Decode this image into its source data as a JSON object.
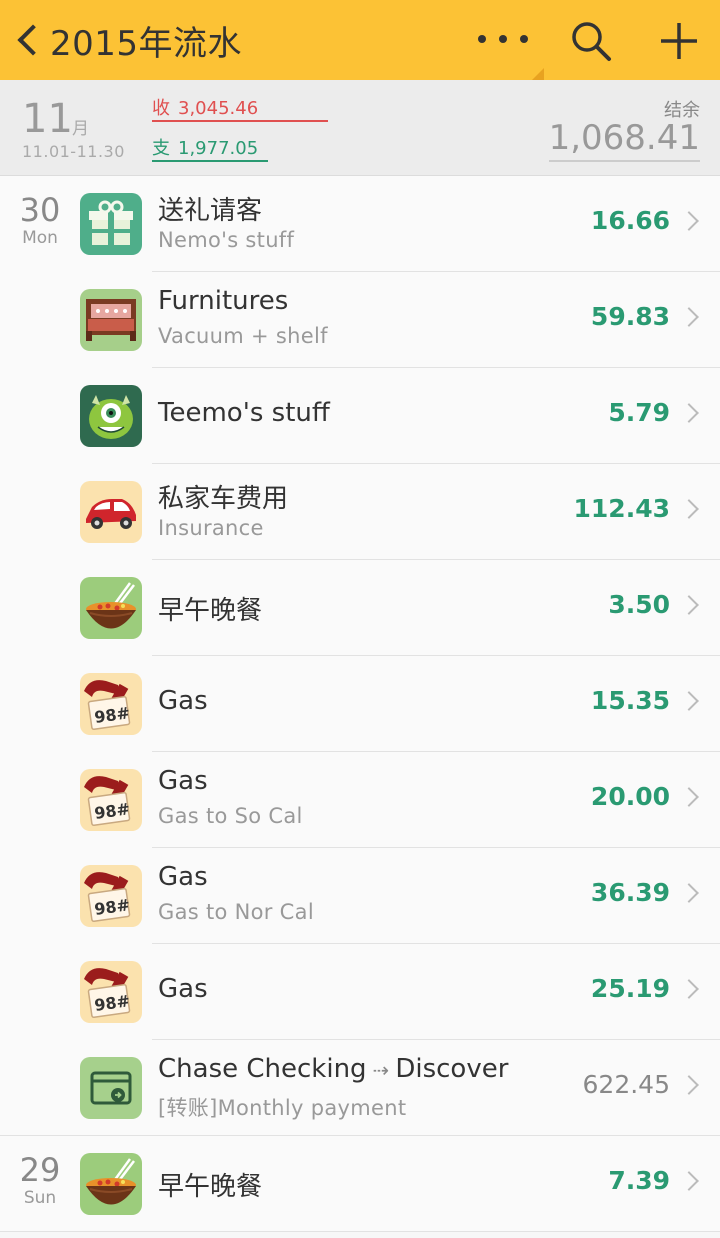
{
  "header": {
    "title": "2015年流水",
    "bg_color": "#fcc235"
  },
  "summary": {
    "month": "11",
    "month_unit": "月",
    "range": "11.01-11.30",
    "income_label": "收",
    "income_value": "3,045.46",
    "expense_label": "支",
    "expense_value": "1,977.05",
    "balance_label": "结余",
    "balance_value": "1,068.41",
    "income_color": "#e05050",
    "expense_color": "#2a9a72"
  },
  "rows": [
    {
      "day": "30",
      "weekday": "Mon",
      "icon": "gift-icon",
      "name": "送礼请客",
      "sub": "Nemo's stuff",
      "amount": "16.66"
    },
    {
      "icon": "bed-icon",
      "name": "Furnitures",
      "sub": "Vacuum + shelf",
      "amount": "59.83"
    },
    {
      "icon": "monster-icon",
      "name": "Teemo's stuff",
      "sub": "",
      "amount": "5.79"
    },
    {
      "icon": "car-icon",
      "name": "私家车费用",
      "sub": "Insurance",
      "amount": "112.43"
    },
    {
      "icon": "noodle-bowl-icon",
      "name": "早午晚餐",
      "sub": "",
      "amount": "3.50"
    },
    {
      "icon": "gas-pump-icon",
      "name": "Gas",
      "sub": "",
      "amount": "15.35"
    },
    {
      "icon": "gas-pump-icon",
      "name": "Gas",
      "sub": "Gas to So Cal",
      "amount": "20.00"
    },
    {
      "icon": "gas-pump-icon",
      "name": "Gas",
      "sub": "Gas to Nor Cal",
      "amount": "36.39"
    },
    {
      "icon": "gas-pump-icon",
      "name": "Gas",
      "sub": "",
      "amount": "25.19"
    },
    {
      "icon": "transfer-icon",
      "name": "Chase Checking",
      "name_to": "Discover",
      "sub": "[转账]Monthly payment",
      "amount": "622.45"
    },
    {
      "day": "29",
      "weekday": "Sun",
      "icon": "noodle-bowl-icon",
      "name": "早午晚餐",
      "sub": "",
      "amount": "7.39"
    }
  ],
  "gas_badge": "98#"
}
